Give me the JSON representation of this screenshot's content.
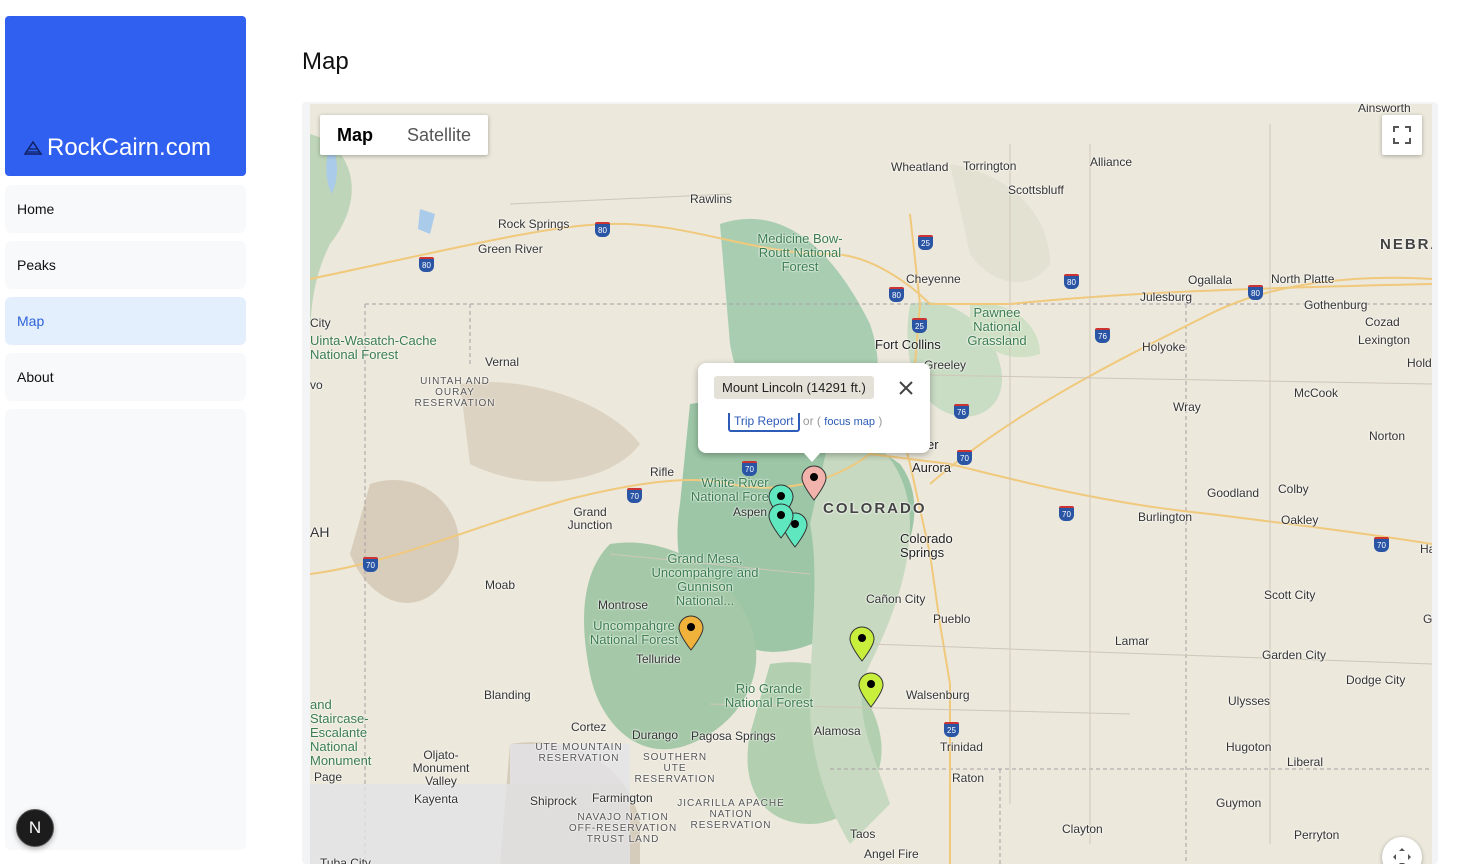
{
  "brand": {
    "name": "RockCairn.com",
    "icon": "cairn-icon"
  },
  "nav": {
    "items": [
      {
        "label": "Home",
        "active": false
      },
      {
        "label": "Peaks",
        "active": false
      },
      {
        "label": "Map",
        "active": true
      },
      {
        "label": "About",
        "active": false
      }
    ]
  },
  "badge": {
    "letter": "N"
  },
  "page": {
    "title": "Map"
  },
  "map": {
    "type_control": {
      "map": "Map",
      "satellite": "Satellite",
      "selected": "Map"
    },
    "labels": {
      "ainsworth": "Ainsworth",
      "wheatland": "Wheatland",
      "torrington": "Torrington",
      "alliance": "Alliance",
      "scottsbluff": "Scottsbluff",
      "rawlins": "Rawlins",
      "rock_springs": "Rock Springs",
      "green_river": "Green River",
      "medicine_bow": "Medicine Bow-Routt National Forest",
      "nebraska": "NEBRA",
      "cheyenne": "Cheyenne",
      "ogallala": "Ogallala",
      "north_platte": "North Platte",
      "julesburg": "Julesburg",
      "gothenburg": "Gothenburg",
      "cozad": "Cozad",
      "lexington": "Lexington",
      "holdrege": "Holdr",
      "pawnee": "Pawnee National Grassland",
      "fort_collins": "Fort Collins",
      "greeley": "Greeley",
      "holyoke": "Holyoke",
      "city_left": "City",
      "uinta": "Uinta-Wasatch-Cache National Forest",
      "vernal": "Vernal",
      "uintah": "UINTAH AND OURAY RESERVATION",
      "vo": "vo",
      "wray": "Wray",
      "mccook": "McCook",
      "norton": "Norton",
      "er": "er",
      "aurora": "Aurora",
      "rifle": "Rifle",
      "white_river": "White River National Forest",
      "aspen": "Aspen",
      "colorado": "COLORADO",
      "goodland": "Goodland",
      "colby": "Colby",
      "burlington": "Burlington",
      "oakley": "Oakley",
      "ah": "AH",
      "grand_junction": "Grand Junction",
      "colorado_springs": "Colorado Springs",
      "ha": "Ha",
      "grand_mesa": "Grand Mesa, Uncompahgre and Gunnison National...",
      "moab": "Moab",
      "montrose": "Montrose",
      "canon_city": "Cañon City",
      "pueblo": "Pueblo",
      "scott_city": "Scott City",
      "g_right": "G",
      "uncompahgre": "Uncompahgre National Forest",
      "telluride": "Telluride",
      "lamar": "Lamar",
      "garden_city": "Garden City",
      "dodge_city": "Dodge City",
      "blanding": "Blanding",
      "rio_grande": "Rio Grande National Forest",
      "walsenburg": "Walsenburg",
      "ulysses": "Ulysses",
      "grand_staircase": "and Staircase-Escalante National Monument",
      "cortez": "Cortez",
      "alamosa": "Alamosa",
      "durango": "Durango",
      "pagosa": "Pagosa Springs",
      "ute_mountain": "UTE MOUNTAIN RESERVATION",
      "southern_ute": "SOUTHERN UTE RESERVATION",
      "trinidad": "Trinidad",
      "hugoton": "Hugoton",
      "liberal": "Liberal",
      "oljato": "Oljato-Monument Valley",
      "page": "Page",
      "raton": "Raton",
      "kayenta": "Kayenta",
      "shiprock": "Shiprock",
      "farmington": "Farmington",
      "guymon": "Guymon",
      "navajo": "NAVAJO NATION OFF-RESERVATION TRUST LAND",
      "jicarilla": "JICARILLA APACHE NATION RESERVATION",
      "clayton": "Clayton",
      "taos": "Taos",
      "perryton": "Perryton",
      "angel_fire": "Angel Fire",
      "tuba_city": "Tuba City"
    },
    "highways": {
      "i80": "80",
      "i25": "25",
      "i76": "76",
      "i70": "70"
    },
    "pin_colors": {
      "pink": "#f2b3ad",
      "teal": "#5fe8bf",
      "orange": "#f0b23a",
      "lime": "#c8ef3c"
    }
  },
  "info_window": {
    "title": "Mount Lincoln (14291 ft.)",
    "trip_report": "Trip Report",
    "or_text": "or (",
    "focus_map": "focus map",
    "close_paren": ")"
  }
}
